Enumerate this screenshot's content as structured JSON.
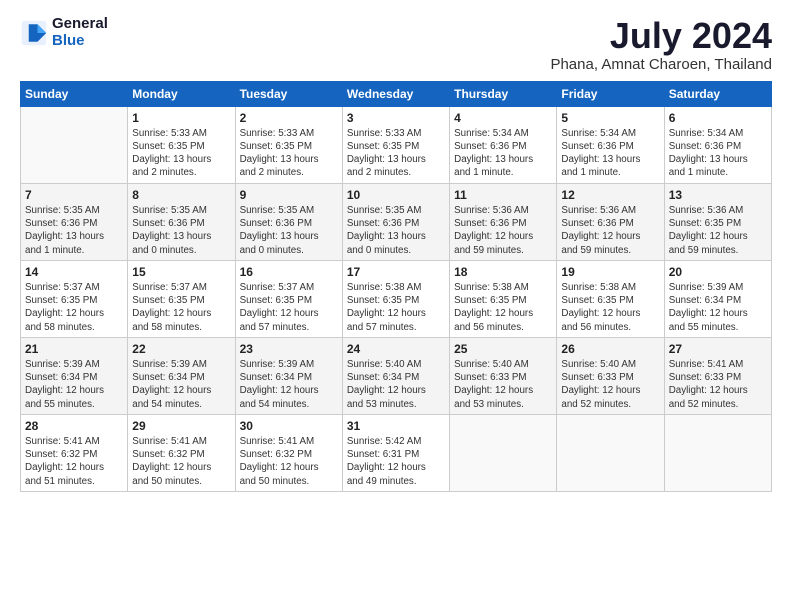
{
  "header": {
    "logo_general": "General",
    "logo_blue": "Blue",
    "title": "July 2024",
    "subtitle": "Phana, Amnat Charoen, Thailand"
  },
  "weekdays": [
    "Sunday",
    "Monday",
    "Tuesday",
    "Wednesday",
    "Thursday",
    "Friday",
    "Saturday"
  ],
  "weeks": [
    [
      {
        "day": "",
        "info": ""
      },
      {
        "day": "1",
        "info": "Sunrise: 5:33 AM\nSunset: 6:35 PM\nDaylight: 13 hours\nand 2 minutes."
      },
      {
        "day": "2",
        "info": "Sunrise: 5:33 AM\nSunset: 6:35 PM\nDaylight: 13 hours\nand 2 minutes."
      },
      {
        "day": "3",
        "info": "Sunrise: 5:33 AM\nSunset: 6:35 PM\nDaylight: 13 hours\nand 2 minutes."
      },
      {
        "day": "4",
        "info": "Sunrise: 5:34 AM\nSunset: 6:36 PM\nDaylight: 13 hours\nand 1 minute."
      },
      {
        "day": "5",
        "info": "Sunrise: 5:34 AM\nSunset: 6:36 PM\nDaylight: 13 hours\nand 1 minute."
      },
      {
        "day": "6",
        "info": "Sunrise: 5:34 AM\nSunset: 6:36 PM\nDaylight: 13 hours\nand 1 minute."
      }
    ],
    [
      {
        "day": "7",
        "info": "Sunrise: 5:35 AM\nSunset: 6:36 PM\nDaylight: 13 hours\nand 1 minute."
      },
      {
        "day": "8",
        "info": "Sunrise: 5:35 AM\nSunset: 6:36 PM\nDaylight: 13 hours\nand 0 minutes."
      },
      {
        "day": "9",
        "info": "Sunrise: 5:35 AM\nSunset: 6:36 PM\nDaylight: 13 hours\nand 0 minutes."
      },
      {
        "day": "10",
        "info": "Sunrise: 5:35 AM\nSunset: 6:36 PM\nDaylight: 13 hours\nand 0 minutes."
      },
      {
        "day": "11",
        "info": "Sunrise: 5:36 AM\nSunset: 6:36 PM\nDaylight: 12 hours\nand 59 minutes."
      },
      {
        "day": "12",
        "info": "Sunrise: 5:36 AM\nSunset: 6:36 PM\nDaylight: 12 hours\nand 59 minutes."
      },
      {
        "day": "13",
        "info": "Sunrise: 5:36 AM\nSunset: 6:35 PM\nDaylight: 12 hours\nand 59 minutes."
      }
    ],
    [
      {
        "day": "14",
        "info": "Sunrise: 5:37 AM\nSunset: 6:35 PM\nDaylight: 12 hours\nand 58 minutes."
      },
      {
        "day": "15",
        "info": "Sunrise: 5:37 AM\nSunset: 6:35 PM\nDaylight: 12 hours\nand 58 minutes."
      },
      {
        "day": "16",
        "info": "Sunrise: 5:37 AM\nSunset: 6:35 PM\nDaylight: 12 hours\nand 57 minutes."
      },
      {
        "day": "17",
        "info": "Sunrise: 5:38 AM\nSunset: 6:35 PM\nDaylight: 12 hours\nand 57 minutes."
      },
      {
        "day": "18",
        "info": "Sunrise: 5:38 AM\nSunset: 6:35 PM\nDaylight: 12 hours\nand 56 minutes."
      },
      {
        "day": "19",
        "info": "Sunrise: 5:38 AM\nSunset: 6:35 PM\nDaylight: 12 hours\nand 56 minutes."
      },
      {
        "day": "20",
        "info": "Sunrise: 5:39 AM\nSunset: 6:34 PM\nDaylight: 12 hours\nand 55 minutes."
      }
    ],
    [
      {
        "day": "21",
        "info": "Sunrise: 5:39 AM\nSunset: 6:34 PM\nDaylight: 12 hours\nand 55 minutes."
      },
      {
        "day": "22",
        "info": "Sunrise: 5:39 AM\nSunset: 6:34 PM\nDaylight: 12 hours\nand 54 minutes."
      },
      {
        "day": "23",
        "info": "Sunrise: 5:39 AM\nSunset: 6:34 PM\nDaylight: 12 hours\nand 54 minutes."
      },
      {
        "day": "24",
        "info": "Sunrise: 5:40 AM\nSunset: 6:34 PM\nDaylight: 12 hours\nand 53 minutes."
      },
      {
        "day": "25",
        "info": "Sunrise: 5:40 AM\nSunset: 6:33 PM\nDaylight: 12 hours\nand 53 minutes."
      },
      {
        "day": "26",
        "info": "Sunrise: 5:40 AM\nSunset: 6:33 PM\nDaylight: 12 hours\nand 52 minutes."
      },
      {
        "day": "27",
        "info": "Sunrise: 5:41 AM\nSunset: 6:33 PM\nDaylight: 12 hours\nand 52 minutes."
      }
    ],
    [
      {
        "day": "28",
        "info": "Sunrise: 5:41 AM\nSunset: 6:32 PM\nDaylight: 12 hours\nand 51 minutes."
      },
      {
        "day": "29",
        "info": "Sunrise: 5:41 AM\nSunset: 6:32 PM\nDaylight: 12 hours\nand 50 minutes."
      },
      {
        "day": "30",
        "info": "Sunrise: 5:41 AM\nSunset: 6:32 PM\nDaylight: 12 hours\nand 50 minutes."
      },
      {
        "day": "31",
        "info": "Sunrise: 5:42 AM\nSunset: 6:31 PM\nDaylight: 12 hours\nand 49 minutes."
      },
      {
        "day": "",
        "info": ""
      },
      {
        "day": "",
        "info": ""
      },
      {
        "day": "",
        "info": ""
      }
    ]
  ]
}
